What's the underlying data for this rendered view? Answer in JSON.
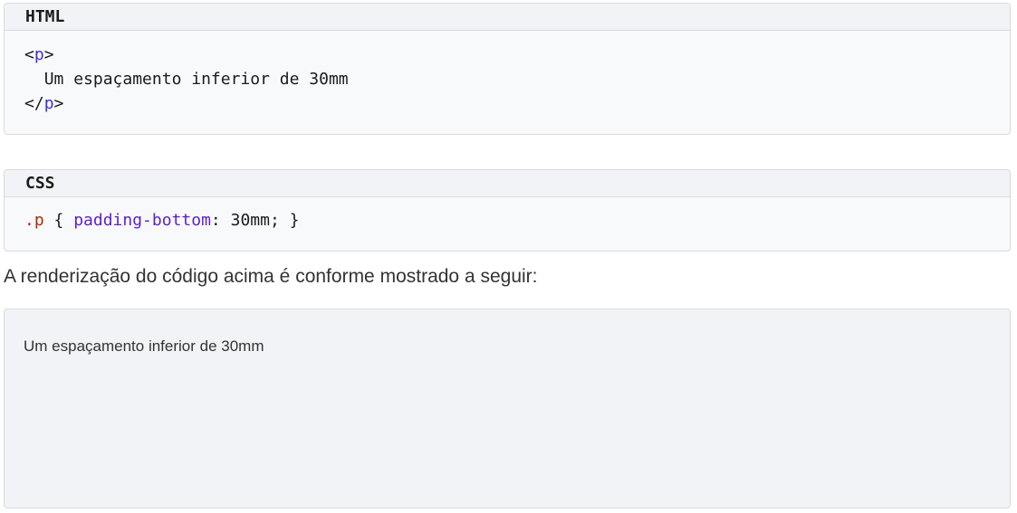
{
  "html_example": {
    "header": "HTML",
    "line1_open": "<",
    "line1_tag": "p",
    "line1_close": ">",
    "line2_text": "Um espaçamento inferior de 30mm",
    "line3_open": "</",
    "line3_tag": "p",
    "line3_close": ">"
  },
  "css_example": {
    "header": "CSS",
    "selector": ".p",
    "brace_open": " { ",
    "property": "padding-bottom",
    "colon": ": ",
    "value": "30mm",
    "end": "; }"
  },
  "caption": "A renderização do código acima é conforme mostrado a seguir:",
  "rendered_output": {
    "text": "Um espaçamento inferior de 30mm"
  },
  "colors": {
    "tag": "#3b33d6",
    "selector": "#b22b00",
    "property": "#5b1fd1",
    "render_background": "#f1f3f6"
  }
}
